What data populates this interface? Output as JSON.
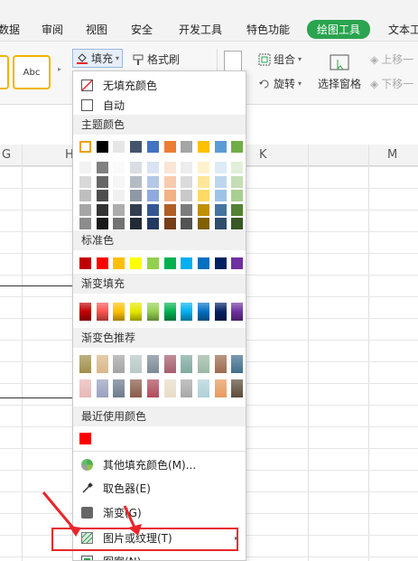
{
  "tabs": [
    "数据",
    "审阅",
    "视图",
    "安全",
    "开发工具",
    "特色功能",
    "绘图工具",
    "文本工"
  ],
  "ribbon": {
    "style_label": "Abc",
    "fill_label": "填充",
    "format_brush_label": "格式刷",
    "group_label": "组合",
    "rotate_label": "旋转",
    "selection_pane_label": "选择窗格",
    "up_label": "上移一",
    "down_label": "下移一"
  },
  "columns": [
    "G",
    "H",
    "K",
    "M"
  ],
  "menu": {
    "no_fill": "无填充颜色",
    "auto": "自动",
    "theme_title": "主题颜色",
    "standard_title": "标准色",
    "gradient_title": "渐变填充",
    "gradient_rec_title": "渐变色推荐",
    "recent_title": "最近使用颜色",
    "more_colors": "其他填充颜色(M)...",
    "eyedropper": "取色器(E)",
    "gradient": "渐变(G)",
    "picture": "图片或纹理(T)",
    "pattern": "图案(N)"
  },
  "colors": {
    "accent": "#2aa44f",
    "highlight_box": "#e8262b",
    "theme_top": [
      "#ffffff",
      "#000000",
      "#e7e6e6",
      "#44546a",
      "#4472c4",
      "#ed7d31",
      "#a5a5a5",
      "#ffc000",
      "#5b9bd5",
      "#70ad47"
    ],
    "standard": [
      "#c00000",
      "#ff0000",
      "#ffc000",
      "#ffff00",
      "#92d050",
      "#00b050",
      "#00b0f0",
      "#0070c0",
      "#002060",
      "#7030a0"
    ],
    "gradient": [
      "#c00000",
      "#ff5050",
      "#ffc000",
      "#e6e600",
      "#92d050",
      "#00b050",
      "#00b0f0",
      "#0070c0",
      "#002060",
      "#7030a0"
    ],
    "gradient_rec_row1": [
      "#a08f4e",
      "#d9b78a",
      "#a4a4a4",
      "#b8c9c6",
      "#7b8a96",
      "#a65e6e",
      "#7fa9a0",
      "#9bb8a4",
      "#9c6b4e",
      "#3f6e8c"
    ],
    "gradient_rec_row2": [
      "#e8b7b7",
      "#9aa0c0",
      "#6e7a8c",
      "#8a5a4a",
      "#b04a5a",
      "#e8dcc8",
      "#a8a8a8",
      "#b0d0d8",
      "#e89a5a",
      "#5a4a3a"
    ],
    "recent": [
      "#ff0000"
    ]
  }
}
